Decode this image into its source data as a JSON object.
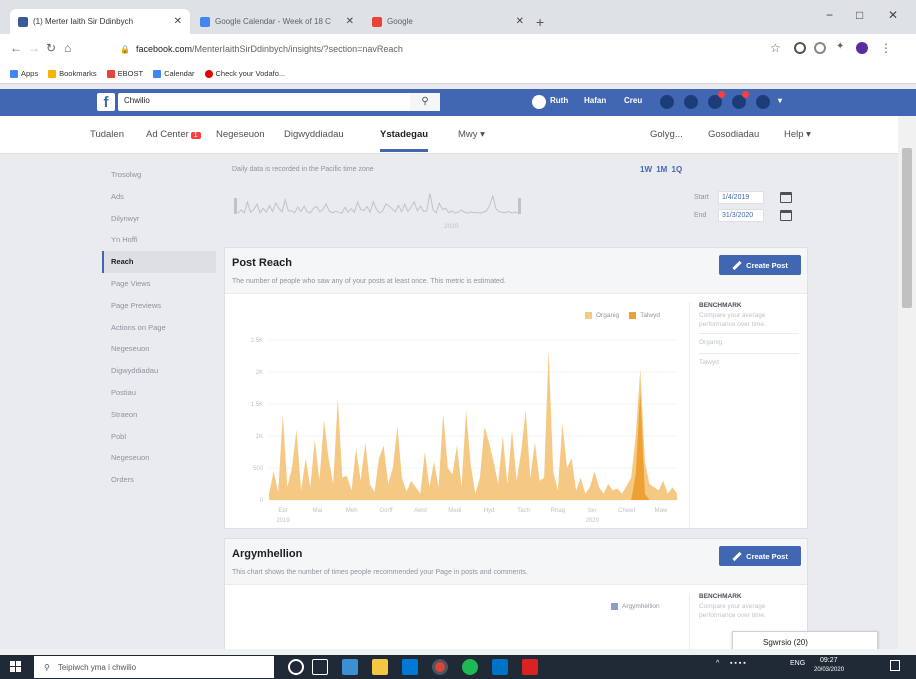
{
  "browser": {
    "tabs": [
      {
        "title": "(1) Merter Iaith Sir Ddinbych",
        "fav_color": "#3b5998"
      },
      {
        "title": "Google Calendar - Week of 18 C",
        "fav_color": "#4285f4"
      },
      {
        "title": "Google",
        "fav_color": "#ea4335"
      }
    ],
    "new_tab": "+",
    "window_controls": {
      "minimize": "−",
      "maximize": "□",
      "close": "✕"
    },
    "url_host": "facebook.com",
    "url_path": "/MenterIaithSirDdinbych/insights/?section=navReach",
    "bookmarks": [
      {
        "label": "Apps",
        "color": "#4285f4"
      },
      {
        "label": "Bookmarks",
        "color": "#f4b400"
      },
      {
        "label": "EBOST",
        "color": "#ea4335"
      },
      {
        "label": "Calendar",
        "color": "#4285f4"
      },
      {
        "label": "Check your Vodafo...",
        "color": "#e60000"
      }
    ]
  },
  "fb": {
    "search_value": "Chwilio",
    "nav": {
      "profile": "Ruth",
      "home": "Hafan",
      "create": "Creu"
    },
    "page_tabs": [
      {
        "label": "Tudalen"
      },
      {
        "label": "Ad Center",
        "badge": "1"
      },
      {
        "label": "Negeseuon"
      },
      {
        "label": "Digwyddiadau"
      },
      {
        "label": "Ystadegau"
      },
      {
        "label": "Mwy ▾"
      },
      {
        "label": "Golyg..."
      },
      {
        "label": "Gosodiadau"
      },
      {
        "label": "Help ▾"
      }
    ]
  },
  "sidebar": {
    "items": [
      "Trosolwg",
      "Ads",
      "Dilynwyr",
      "Yn Hoffi",
      "Reach",
      "Page Views",
      "Page Previews",
      "Actions on Page",
      "Negeseuon",
      "Digwyddiadau",
      "Postiau",
      "Straeon",
      "Pobl",
      "Negeseuon",
      "Orders"
    ],
    "active_index": 4
  },
  "range": {
    "note": "Daily data is recorded in the Pacific time zone",
    "buttons": "1W 1M 1Q",
    "start_label": "Start",
    "start_value": "1/4/2019",
    "end_label": "End",
    "end_value": "31/3/2020",
    "axis_label": "2020"
  },
  "post_reach": {
    "title": "Post Reach",
    "description": "The number of people who saw any of your posts at least once. This metric is estimated.",
    "create_button": "Create Post",
    "legend": [
      {
        "name": "Organig",
        "color": "#f5c984"
      },
      {
        "name": "Talwyd",
        "color": "#eda133"
      }
    ],
    "benchmark": {
      "title": "BENCHMARK",
      "desc": "Compare your average performance over time.",
      "rows": [
        "Organig",
        "Talwyd"
      ]
    }
  },
  "argymhellion": {
    "title": "Argymhellion",
    "description": "This chart shows the number of times people recommended your Page in posts and comments.",
    "create_button": "Create Post",
    "legend": [
      {
        "name": "Argymhellion",
        "color": "#8c9fc9"
      }
    ],
    "benchmark": {
      "title": "BENCHMARK",
      "desc": "Compare your average performance over time.",
      "rows": [
        "Argymhellion"
      ]
    }
  },
  "popup": {
    "text": "Sgwrsio (20)"
  },
  "taskbar": {
    "search_placeholder": "Teipiwch yma i chwilio",
    "time": "09:27",
    "date": "20/03/2020",
    "lang": "ENG"
  },
  "chart_data": [
    {
      "type": "area",
      "title": "Post Reach",
      "x": [
        "Ebr 2019",
        "Mai",
        "Meh",
        "Gorff",
        "Awst",
        "Medi",
        "Hyd",
        "Tach",
        "Rhag",
        "Ion 2020",
        "Chwef",
        "Maw"
      ],
      "y_ticks": [
        "0",
        "500",
        "1K",
        "1.5K",
        "2K",
        "2.5K"
      ],
      "ylim": [
        0,
        2500
      ],
      "series": [
        {
          "name": "Organig",
          "values": [
            90,
            450,
            120,
            1350,
            200,
            500,
            1100,
            150,
            650,
            200,
            950,
            300,
            1250,
            650,
            250,
            1600,
            350,
            380,
            150,
            800,
            300,
            900,
            250,
            120,
            650,
            850,
            250,
            500,
            1150,
            350,
            130,
            300,
            200,
            100,
            750,
            200,
            600,
            200,
            1350,
            500,
            400,
            850,
            200,
            1400,
            550,
            100,
            350,
            1150,
            900,
            600,
            250,
            1000,
            250,
            1100,
            300,
            750,
            1400,
            350,
            900,
            300,
            350,
            2350,
            450,
            150,
            1200,
            500,
            650,
            150,
            350,
            100,
            200,
            450,
            200,
            100,
            250,
            150,
            180,
            100,
            220,
            350,
            1000,
            2050,
            600,
            250,
            200,
            150,
            300,
            100,
            200,
            100
          ]
        },
        {
          "name": "Talwyd",
          "values": [
            0,
            0,
            0,
            0,
            0,
            0,
            0,
            0,
            0,
            0,
            0,
            0,
            0,
            0,
            0,
            0,
            0,
            0,
            0,
            0,
            0,
            0,
            0,
            0,
            0,
            0,
            0,
            0,
            0,
            0,
            0,
            0,
            0,
            0,
            0,
            0,
            0,
            0,
            0,
            0,
            0,
            0,
            0,
            0,
            0,
            0,
            0,
            0,
            0,
            0,
            0,
            0,
            0,
            0,
            0,
            0,
            0,
            0,
            0,
            0,
            0,
            0,
            0,
            0,
            0,
            0,
            0,
            0,
            0,
            0,
            0,
            0,
            0,
            0,
            0,
            0,
            0,
            0,
            0,
            0,
            400,
            1700,
            100,
            0,
            0,
            0,
            0,
            0,
            0,
            0
          ]
        }
      ]
    }
  ]
}
